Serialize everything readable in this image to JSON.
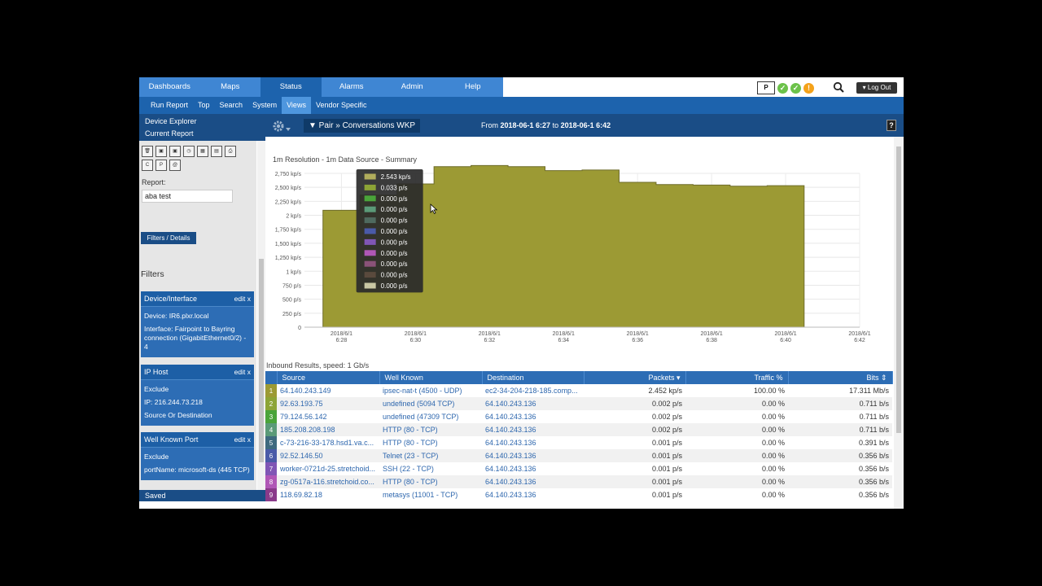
{
  "nav": {
    "tabs": [
      "Dashboards",
      "Maps",
      "Status",
      "Alarms",
      "Admin",
      "Help"
    ],
    "active": "Status",
    "p_icon": "P",
    "logout": "Log Out"
  },
  "subnav": {
    "tabs": [
      "Run Report",
      "Top",
      "Search",
      "System",
      "Views",
      "Vendor Specific"
    ],
    "active": "Views"
  },
  "sidebar": {
    "device_explorer": "Device Explorer",
    "current_report": "Current Report",
    "report_label": "Report:",
    "report_value": "aba test",
    "filters_button": "Filters / Details",
    "filters_label": "Filters",
    "cards": [
      {
        "title": "Device/Interface",
        "edit": "edit",
        "close": "x",
        "lines": [
          "Device: IR6.plxr.local",
          "Interface: Fairpoint to Bayring connection (GigabitEthernet0/2) - 4"
        ]
      },
      {
        "title": "IP Host",
        "edit": "edit",
        "close": "x",
        "lines": [
          "Exclude",
          "IP: 216.244.73.218",
          "Source Or Destination"
        ]
      },
      {
        "title": "Well Known Port",
        "edit": "edit",
        "close": "x",
        "lines": [
          "Exclude",
          "portName: microsoft-ds (445 TCP)"
        ]
      }
    ],
    "saved": "Saved"
  },
  "header": {
    "pair_button": "▼ Pair » Conversations WKP",
    "from_label": "From",
    "from": "2018-06-1 6:27",
    "to_label": "to",
    "to": "2018-06-1 6:42",
    "help": "?"
  },
  "chart_data": {
    "type": "area",
    "title": "1m Resolution - 1m Data Source - Summary",
    "y_unit": "kp/s",
    "ylim": [
      0,
      2750
    ],
    "y_ticks": [
      "0",
      "250 p/s",
      "500 p/s",
      "750 p/s",
      "1 kp/s",
      "1,250 kp/s",
      "1,500 kp/s",
      "1,750 kp/s",
      "2 kp/s",
      "2,250 kp/s",
      "2,500 kp/s",
      "2,750 kp/s"
    ],
    "x_ticks": [
      "2018/6/1 6:28",
      "2018/6/1 6:30",
      "2018/6/1 6:32",
      "2018/6/1 6:34",
      "2018/6/1 6:36",
      "2018/6/1 6:38",
      "2018/6/1 6:40",
      "2018/6/1 6:42"
    ],
    "x_minutes": [
      6.5,
      7.5,
      8.5,
      9.5,
      10.5,
      11.5,
      12.5,
      13.5,
      14.5,
      15.5,
      16.5,
      17.5,
      18.5,
      19.5
    ],
    "x_range": [
      27,
      42
    ],
    "series": [
      {
        "values": [
          2090,
          2360,
          2560,
          2870,
          2890,
          2870,
          2800,
          2810,
          2590,
          2550,
          2540,
          2520,
          2530
        ]
      }
    ],
    "colors": [
      "#9c9a34"
    ],
    "tooltip": [
      {
        "color": "#b1ad5c",
        "label": "2.543 kp/s"
      },
      {
        "color": "#8da436",
        "label": "0.033 p/s"
      },
      {
        "color": "#4aa43a",
        "label": "0.000 p/s"
      },
      {
        "color": "#5b9a78",
        "label": "0.000 p/s"
      },
      {
        "color": "#4f6a5f",
        "label": "0.000 p/s"
      },
      {
        "color": "#4a5aa8",
        "label": "0.000 p/s"
      },
      {
        "color": "#8056b5",
        "label": "0.000 p/s"
      },
      {
        "color": "#b057b6",
        "label": "0.000 p/s"
      },
      {
        "color": "#8a5278",
        "label": "0.000 p/s"
      },
      {
        "color": "#5a4a3d",
        "label": "0.000 p/s"
      },
      {
        "color": "#c9c7a4",
        "label": "0.000 p/s"
      }
    ]
  },
  "inbound_label": "Inbound Results, speed: 1 Gb/s",
  "table": {
    "columns": [
      "Source",
      "Well Known",
      "Destination",
      "Packets ▾",
      "Traffic % ",
      "Bits ⇕"
    ],
    "rows": [
      {
        "n": "1",
        "color": "#9c9a34",
        "source": "64.140.243.149",
        "wk": "ipsec-nat-t (4500 - UDP)",
        "dest": "ec2-34-204-218-185.comp...",
        "packets": "2.452 kp/s",
        "traffic": "100.00 %",
        "bits": "17.311 Mb/s"
      },
      {
        "n": "2",
        "color": "#8da436",
        "source": "92.63.193.75",
        "wk": "undefined (5094 TCP)",
        "dest": "64.140.243.136",
        "packets": "0.002 p/s",
        "traffic": "0.00 %",
        "bits": "0.711 b/s"
      },
      {
        "n": "3",
        "color": "#4aa43a",
        "source": "79.124.56.142",
        "wk": "undefined (47309 TCP)",
        "dest": "64.140.243.136",
        "packets": "0.002 p/s",
        "traffic": "0.00 %",
        "bits": "0.711 b/s"
      },
      {
        "n": "4",
        "color": "#5b9a78",
        "source": "185.208.208.198",
        "wk": "HTTP (80 - TCP)",
        "dest": "64.140.243.136",
        "packets": "0.002 p/s",
        "traffic": "0.00 %",
        "bits": "0.711 b/s"
      },
      {
        "n": "5",
        "color": "#3f6a7f",
        "source": "c-73-216-33-178.hsd1.va.c...",
        "wk": "HTTP (80 - TCP)",
        "dest": "64.140.243.136",
        "packets": "0.001 p/s",
        "traffic": "0.00 %",
        "bits": "0.391 b/s"
      },
      {
        "n": "6",
        "color": "#4a5aa8",
        "source": "92.52.146.50",
        "wk": "Telnet (23 - TCP)",
        "dest": "64.140.243.136",
        "packets": "0.001 p/s",
        "traffic": "0.00 %",
        "bits": "0.356 b/s"
      },
      {
        "n": "7",
        "color": "#8056b5",
        "source": "worker-0721d-25.stretchoid...",
        "wk": "SSH (22 - TCP)",
        "dest": "64.140.243.136",
        "packets": "0.001 p/s",
        "traffic": "0.00 %",
        "bits": "0.356 b/s"
      },
      {
        "n": "8",
        "color": "#b057b6",
        "source": "zg-0517a-116.stretchoid.co...",
        "wk": "HTTP (80 - TCP)",
        "dest": "64.140.243.136",
        "packets": "0.001 p/s",
        "traffic": "0.00 %",
        "bits": "0.356 b/s"
      },
      {
        "n": "9",
        "color": "#8a3a8a",
        "source": "118.69.82.18",
        "wk": "metasys (11001 - TCP)",
        "dest": "64.140.243.136",
        "packets": "0.001 p/s",
        "traffic": "0.00 %",
        "bits": "0.356 b/s"
      }
    ]
  }
}
